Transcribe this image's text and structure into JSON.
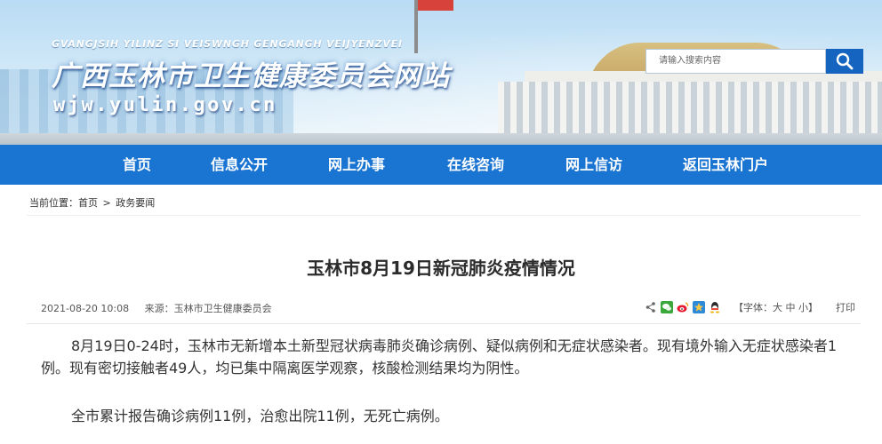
{
  "header": {
    "pinyin": "GVANGJSIH YILINZ SI VEISWNGH GENGANGH VEIJYENZVEI",
    "title": "广西玉林市卫生健康委员会网站",
    "domain": "wjw.yulin.gov.cn"
  },
  "search": {
    "placeholder": "请输入搜索内容",
    "icon": "search-icon"
  },
  "nav": {
    "items": [
      "首页",
      "信息公开",
      "网上办事",
      "在线咨询",
      "网上信访",
      "返回玉林门户"
    ]
  },
  "breadcrumb": {
    "prefix": "当前位置：",
    "home": "首页",
    "separator": ">",
    "current": "政务要闻"
  },
  "article": {
    "title": "玉林市8月19日新冠肺炎疫情情况",
    "date": "2021-08-20 10:08",
    "source": "来源：玉林市卫生健康委员会",
    "font_label": "【字体：大 中 小】",
    "print_label": "打印",
    "share_icons": [
      "share-icon",
      "wechat-icon",
      "weibo-icon",
      "qzone-icon",
      "qq-icon"
    ],
    "paragraphs": [
      "8月19日0-24时，玉林市无新增本土新型冠状病毒肺炎确诊病例、疑似病例和无症状感染者。现有境外输入无症状感染者1例。现有密切接触者49人，均已集中隔离医学观察，核酸检测结果均为阴性。",
      "全市累计报告确诊病例11例，治愈出院11例，无死亡病例。"
    ]
  },
  "colors": {
    "nav_bg": "#1a74d2",
    "search_button": "#1565c0",
    "text": "#333333"
  }
}
